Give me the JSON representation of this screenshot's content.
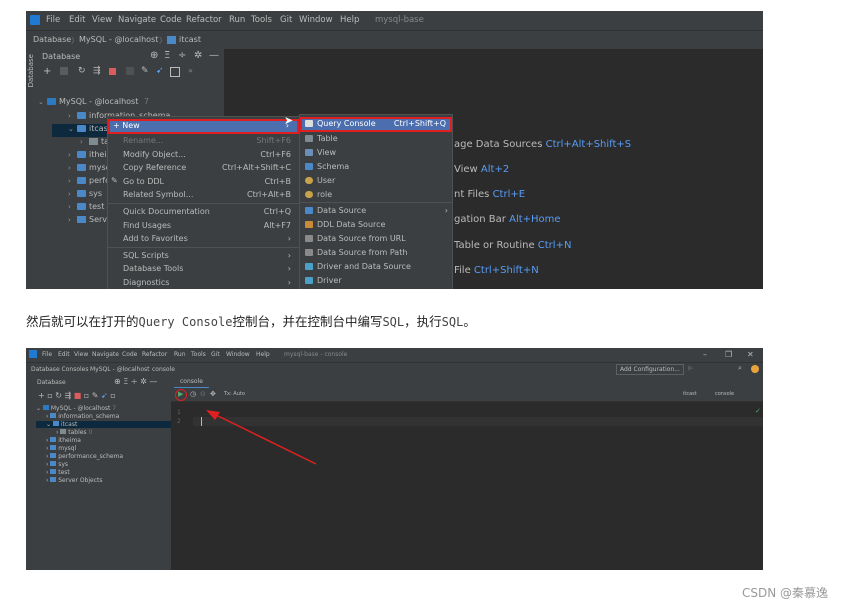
{
  "shot1": {
    "menu": [
      "File",
      "Edit",
      "View",
      "Navigate",
      "Code",
      "Refactor",
      "Run",
      "Tools",
      "Git",
      "Window",
      "Help"
    ],
    "project": "mysql-base",
    "breadcrumb": [
      "Database",
      "MySQL - @localhost",
      "itcast"
    ],
    "panel_title": "Database",
    "tree": {
      "root": "MySQL - @localhost",
      "root_count": "7",
      "items": [
        "information_schema",
        "itcast",
        "tab",
        "itheima",
        "mysql",
        "perfor",
        "sys",
        "test",
        "Server"
      ]
    },
    "context_menu": [
      {
        "label": "New",
        "shortcut": ""
      },
      {
        "label": "Rename...",
        "shortcut": "Shift+F6"
      },
      {
        "label": "Modify Object...",
        "shortcut": "Ctrl+F6"
      },
      {
        "label": "Copy Reference",
        "shortcut": "Ctrl+Alt+Shift+C"
      },
      {
        "label": "Go to DDL",
        "shortcut": "Ctrl+B"
      },
      {
        "label": "Related Symbol...",
        "shortcut": "Ctrl+Alt+B"
      },
      {
        "label": "Quick Documentation",
        "shortcut": "Ctrl+Q"
      },
      {
        "label": "Find Usages",
        "shortcut": "Alt+F7"
      },
      {
        "label": "Add to Favorites",
        "shortcut": ""
      },
      {
        "label": "SQL Scripts",
        "shortcut": ""
      },
      {
        "label": "Database Tools",
        "shortcut": ""
      },
      {
        "label": "Diagnostics",
        "shortcut": ""
      }
    ],
    "submenu": [
      {
        "label": "Query Console",
        "shortcut": "Ctrl+Shift+Q"
      },
      {
        "label": "Table",
        "shortcut": ""
      },
      {
        "label": "View",
        "shortcut": ""
      },
      {
        "label": "Schema",
        "shortcut": ""
      },
      {
        "label": "User",
        "shortcut": ""
      },
      {
        "label": "role",
        "shortcut": ""
      },
      {
        "label": "Data Source",
        "shortcut": ""
      },
      {
        "label": "DDL Data Source",
        "shortcut": ""
      },
      {
        "label": "Data Source from URL",
        "shortcut": ""
      },
      {
        "label": "Data Source from Path",
        "shortcut": ""
      },
      {
        "label": "Driver and Data Source",
        "shortcut": ""
      },
      {
        "label": "Driver",
        "shortcut": ""
      }
    ],
    "welcome": [
      {
        "text": "age Data Sources",
        "key": "Ctrl+Alt+Shift+S"
      },
      {
        "text": "View",
        "key": "Alt+2"
      },
      {
        "text": "nt Files",
        "key": "Ctrl+E"
      },
      {
        "text": "gation Bar",
        "key": "Alt+Home"
      },
      {
        "text": "Table or Routine",
        "key": "Ctrl+N"
      },
      {
        "text": "File",
        "key": "Ctrl+Shift+N"
      }
    ]
  },
  "caption": {
    "part1": "然后就可以在打开的",
    "code1": "Query Console",
    "part2": "控制台，并在控制台中编写",
    "code2": "SQL",
    "part3": "，执行",
    "code3": "SQL",
    "part4": "。"
  },
  "shot2": {
    "menu": [
      "File",
      "Edit",
      "View",
      "Navigate",
      "Code",
      "Refactor",
      "Run",
      "Tools",
      "Git",
      "Window",
      "Help"
    ],
    "project": "mysql-base - console",
    "breadcrumb": [
      "Database Consoles",
      "MySQL - @localhost",
      "console"
    ],
    "add_config": "Add Configuration...",
    "panel_title": "Database",
    "tab_label": "console",
    "tx_label": "Tx: Auto",
    "schema_label": "itcast",
    "console_label": "console",
    "tree": [
      "MySQL - @localhost",
      "information_schema",
      "itcast",
      "tables",
      "itheima",
      "mysql",
      "performance_schema",
      "sys",
      "test",
      "Server Objects"
    ],
    "tree_root_count": "7",
    "tables_count": "0",
    "line_numbers": [
      "1",
      "2"
    ]
  },
  "footer": "CSDN @秦慕逸",
  "colors": {
    "accent": "#589df6",
    "highlight": "#e02020",
    "selection": "#0d293e",
    "menu_sel": "#4b6eaf"
  }
}
